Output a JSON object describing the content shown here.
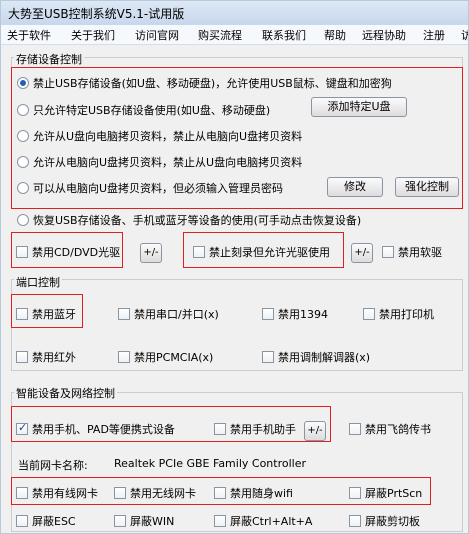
{
  "window": {
    "title": "大势至USB控制系统V5.1-试用版"
  },
  "menu": [
    "关于软件",
    "关于我们",
    "访问官网",
    "购买流程",
    "联系我们",
    "帮助",
    "远程协助",
    "注册",
    "访"
  ],
  "storage": {
    "title": "存储设备控制",
    "options": [
      "禁止USB存储设备(如U盘、移动硬盘)，允许使用USB鼠标、键盘和加密狗",
      "只允许特定USB存储设备使用(如U盘、移动硬盘)",
      "允许从U盘向电脑拷贝资料，禁止从电脑向U盘拷贝资料",
      "允许从电脑向U盘拷贝资料，禁止从U盘向电脑拷贝资料",
      "可以从电脑向U盘拷贝资料，但必须输入管理员密码"
    ],
    "selected_index": 0,
    "add_device_button": "添加特定U盘",
    "modify_button": "修改",
    "strengthen_button": "强化控制"
  },
  "restore": {
    "label": "恢复USB存储设备、手机或蓝牙等设备的使用(可手动点击恢复设备)"
  },
  "optical": {
    "disable_cd": "禁用CD/DVD光驱",
    "toggle": "+/-",
    "no_burn": "禁止刻录但允许光驱使用",
    "toggle2": "+/-",
    "disable_floppy": "禁用软驱"
  },
  "ports": {
    "title": "端口控制",
    "row1": [
      "禁用蓝牙",
      "禁用串口/并口(x)",
      "禁用1394",
      "禁用打印机"
    ],
    "row2": [
      "禁用红外",
      "禁用PCMCIA(x)",
      "禁用调制解调器(x)"
    ]
  },
  "smart": {
    "title": "智能设备及网络控制",
    "phone_pad": "禁用手机、PAD等便携式设备",
    "phone_assistant": "禁用手机助手",
    "toggle": "+/-",
    "feige": "禁用飞鸽传书",
    "nic_label": "当前网卡名称:",
    "nic_value": "Realtek PCIe GBE Family Controller",
    "row_net": [
      "禁用有线网卡",
      "禁用无线网卡",
      "禁用随身wifi",
      "屏蔽PrtScn"
    ],
    "row_keys": [
      "屏蔽ESC",
      "屏蔽WIN",
      "屏蔽Ctrl+Alt+A",
      "屏蔽剪切板"
    ]
  }
}
